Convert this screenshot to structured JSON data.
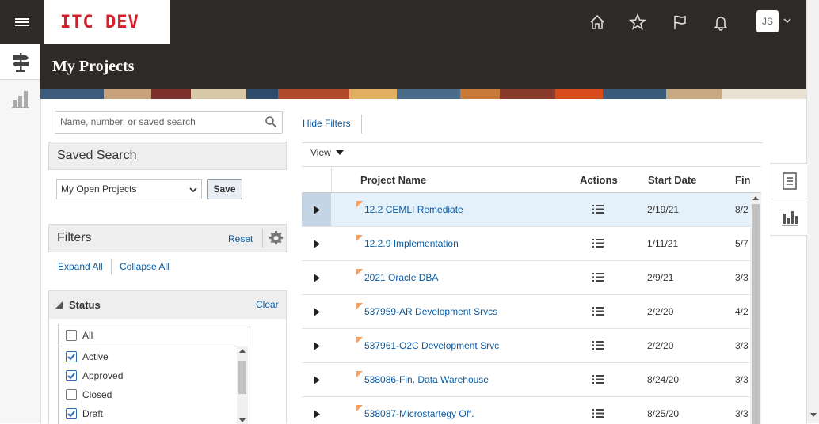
{
  "header": {
    "logo_text": "ITC DEV",
    "avatar_initials": "JS",
    "icons": [
      "hamburger-icon",
      "home-icon",
      "star-icon",
      "flag-icon",
      "bell-icon",
      "chevron-down-icon"
    ]
  },
  "page": {
    "title": "My Projects"
  },
  "search": {
    "placeholder": "Name, number, or saved search"
  },
  "saved_search": {
    "heading": "Saved Search",
    "selected": "My Open Projects",
    "save_label": "Save"
  },
  "filters": {
    "heading": "Filters",
    "reset_label": "Reset",
    "expand_all": "Expand All",
    "collapse_all": "Collapse All"
  },
  "status_filter": {
    "heading": "Status",
    "clear_label": "Clear",
    "options": [
      {
        "label": "All",
        "checked": false
      },
      {
        "label": "Active",
        "checked": true
      },
      {
        "label": "Approved",
        "checked": true
      },
      {
        "label": "Closed",
        "checked": false
      },
      {
        "label": "Draft",
        "checked": true
      }
    ]
  },
  "results": {
    "hide_filters": "Hide Filters",
    "view_label": "View",
    "columns": [
      "Project Name",
      "Actions",
      "Start Date",
      "Fin"
    ],
    "rows": [
      {
        "name": "12.2 CEMLI Remediate",
        "start": "2/19/21",
        "fin": "8/2",
        "selected": true
      },
      {
        "name": "12.2.9 Implementation",
        "start": "1/11/21",
        "fin": "5/7",
        "selected": false
      },
      {
        "name": "2021 Oracle DBA",
        "start": "2/9/21",
        "fin": "3/3",
        "selected": false
      },
      {
        "name": "537959-AR Development Srvcs",
        "start": "2/2/20",
        "fin": "4/2",
        "selected": false
      },
      {
        "name": "537961-O2C Development Srvc",
        "start": "2/2/20",
        "fin": "3/3",
        "selected": false
      },
      {
        "name": "538086-Fin. Data Warehouse",
        "start": "8/24/20",
        "fin": "3/3",
        "selected": false
      },
      {
        "name": "538087-Microstartegy Off.",
        "start": "8/25/20",
        "fin": "3/3",
        "selected": false
      }
    ]
  },
  "colors": {
    "header_bg": "#2d2a27",
    "logo_red": "#d4202c",
    "link": "#0a5aa0",
    "selected_row": "#e4f0fa"
  }
}
